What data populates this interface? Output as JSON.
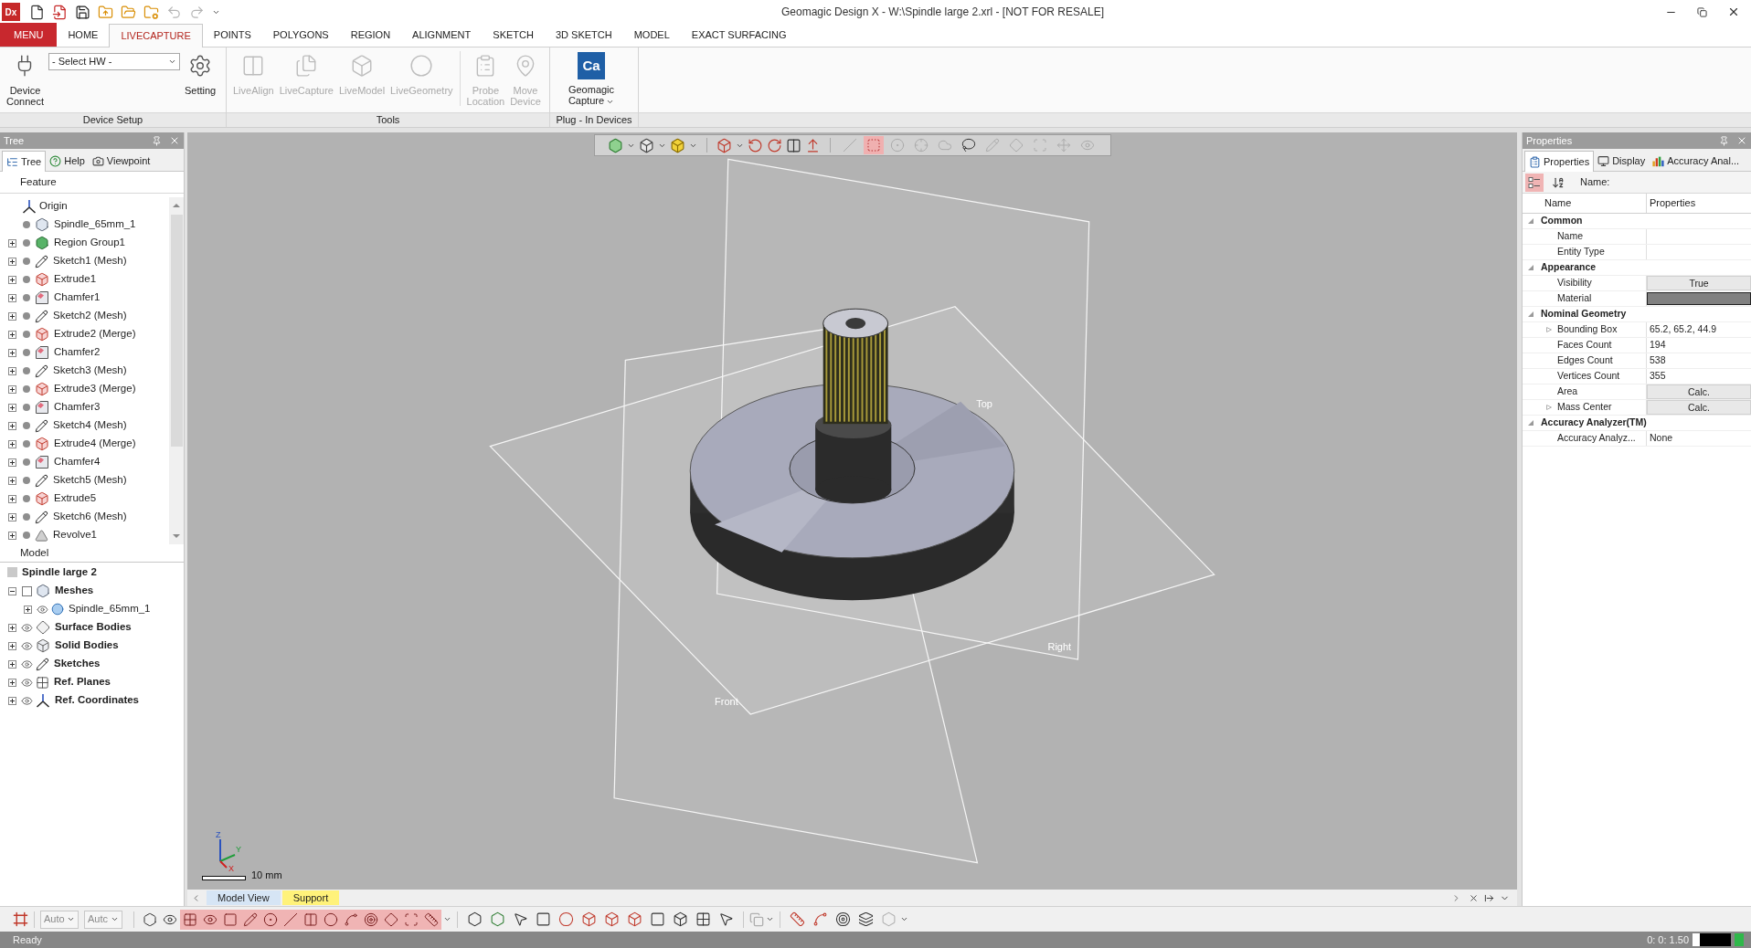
{
  "title_bar": {
    "logo": "Dx",
    "quick_access": [
      {
        "disabled": false
      },
      {
        "disabled": false
      },
      {
        "disabled": false
      },
      {
        "disabled": false
      },
      {
        "disabled": false
      },
      {
        "disabled": false
      },
      {
        "disabled": true
      },
      {
        "disabled": true
      }
    ],
    "title": "Geomagic Design X - W:\\Spindle large 2.xrl - [NOT FOR RESALE]"
  },
  "ribbon_tabs": [
    {
      "label": "MENU",
      "kind": "menu",
      "selected": false
    },
    {
      "label": "HOME",
      "kind": "tab",
      "selected": false
    },
    {
      "label": "LIVECAPTURE",
      "kind": "tab",
      "selected": true
    },
    {
      "label": "POINTS",
      "kind": "tab",
      "selected": false
    },
    {
      "label": "POLYGONS",
      "kind": "tab",
      "selected": false
    },
    {
      "label": "REGION",
      "kind": "tab",
      "selected": false
    },
    {
      "label": "ALIGNMENT",
      "kind": "tab",
      "selected": false
    },
    {
      "label": "SKETCH",
      "kind": "tab",
      "selected": false
    },
    {
      "label": "3D SKETCH",
      "kind": "tab",
      "selected": false
    },
    {
      "label": "MODEL",
      "kind": "tab",
      "selected": false
    },
    {
      "label": "EXACT SURFACING",
      "kind": "tab",
      "selected": false
    }
  ],
  "ribbon": {
    "groups": [
      {
        "label": "Device Setup",
        "sections": [
          [
            {
              "kind": "button",
              "label": "Device Connect",
              "disabled": false
            },
            {
              "kind": "dropdown",
              "value": "- Select HW -"
            },
            {
              "kind": "button",
              "label": "Setting",
              "disabled": false
            }
          ]
        ]
      },
      {
        "label": "Tools",
        "sections": [
          [
            {
              "kind": "button",
              "label": "LiveAlign",
              "disabled": true
            },
            {
              "kind": "button",
              "label": "LiveCapture",
              "disabled": true
            },
            {
              "kind": "button",
              "label": "LiveModel",
              "disabled": true
            },
            {
              "kind": "button",
              "label": "LiveGeometry",
              "disabled": true
            }
          ],
          [
            {
              "kind": "button",
              "label": "Probe Location",
              "disabled": true
            },
            {
              "kind": "button",
              "label": "Move Device",
              "disabled": true
            }
          ]
        ]
      },
      {
        "label": "Plug - In Devices",
        "sections": [
          [
            {
              "kind": "logo",
              "logo": "Ca",
              "label": "Geomagic Capture",
              "disabled": false
            }
          ]
        ]
      }
    ]
  },
  "tree_panel": {
    "title": "Tree",
    "tabs": [
      {
        "label": "Tree",
        "selected": true
      },
      {
        "label": "Help",
        "selected": false
      },
      {
        "label": "Viewpoint",
        "selected": false
      }
    ],
    "feature_header": "Feature",
    "features": [
      {
        "label": "Origin",
        "kind": "origin"
      },
      {
        "label": "Spindle_65mm_1",
        "kind": "mesh"
      },
      {
        "label": "Region Group1",
        "kind": "region",
        "expanded": false
      },
      {
        "label": "Sketch1 (Mesh)",
        "kind": "sketch",
        "expanded": false
      },
      {
        "label": "Extrude1",
        "kind": "extrude",
        "expanded": false
      },
      {
        "label": "Chamfer1",
        "kind": "chamfer",
        "expanded": false
      },
      {
        "label": "Sketch2 (Mesh)",
        "kind": "sketch",
        "expanded": false
      },
      {
        "label": "Extrude2 (Merge)",
        "kind": "extrude",
        "expanded": false
      },
      {
        "label": "Chamfer2",
        "kind": "chamfer",
        "expanded": false
      },
      {
        "label": "Sketch3 (Mesh)",
        "kind": "sketch",
        "expanded": false
      },
      {
        "label": "Extrude3 (Merge)",
        "kind": "extrude",
        "expanded": false
      },
      {
        "label": "Chamfer3",
        "kind": "chamfer",
        "expanded": false
      },
      {
        "label": "Sketch4 (Mesh)",
        "kind": "sketch",
        "expanded": false
      },
      {
        "label": "Extrude4 (Merge)",
        "kind": "extrude",
        "expanded": false
      },
      {
        "label": "Chamfer4",
        "kind": "chamfer",
        "expanded": false
      },
      {
        "label": "Sketch5 (Mesh)",
        "kind": "sketch",
        "expanded": false
      },
      {
        "label": "Extrude5",
        "kind": "extrude",
        "expanded": false
      },
      {
        "label": "Sketch6 (Mesh)",
        "kind": "sketch",
        "expanded": false
      },
      {
        "label": "Revolve1",
        "kind": "revolve",
        "expanded": false
      }
    ],
    "model_header": "Model",
    "model": {
      "label": "Spindle large 2",
      "kind": "root",
      "children": [
        {
          "label": "Meshes",
          "kind": "meshes",
          "expanded": true,
          "checked": false,
          "children": [
            {
              "label": "Spindle_65mm_1",
              "kind": "entity",
              "expanded": false
            }
          ]
        },
        {
          "label": "Surface Bodies",
          "kind": "surface",
          "expanded": false
        },
        {
          "label": "Solid Bodies",
          "kind": "solid",
          "expanded": false
        },
        {
          "label": "Sketches",
          "kind": "sketches",
          "expanded": false
        },
        {
          "label": "Ref. Planes",
          "kind": "planes",
          "expanded": false
        },
        {
          "label": "Ref. Coordinates",
          "kind": "coordinates",
          "expanded": false
        }
      ]
    }
  },
  "viewport": {
    "selection_tools": [
      {
        "on": false,
        "disabled": true
      },
      {
        "on": true,
        "disabled": false
      },
      {
        "on": false,
        "disabled": true
      },
      {
        "on": false,
        "disabled": true
      },
      {
        "on": false,
        "disabled": true
      },
      {
        "on": false,
        "disabled": false
      },
      {
        "on": false,
        "disabled": true
      },
      {
        "on": false,
        "disabled": true
      },
      {
        "on": false,
        "disabled": true
      },
      {
        "on": false,
        "disabled": true
      },
      {
        "on": false,
        "disabled": true
      }
    ],
    "plane_labels": [
      "Top",
      "Right",
      "Front"
    ],
    "axes": [
      "Z",
      "Y",
      "X"
    ],
    "scale": "10 mm",
    "tabs": [
      {
        "label": "Model View",
        "color": "#d6e5f5"
      },
      {
        "label": "Support",
        "color": "#fff27a"
      }
    ]
  },
  "properties_panel": {
    "title": "Properties",
    "tabs": [
      {
        "label": "Properties",
        "selected": true
      },
      {
        "label": "Display",
        "selected": false
      },
      {
        "label": "Accuracy Anal...",
        "selected": false
      }
    ],
    "view_buttons": [
      {
        "on": true
      },
      {
        "on": false
      }
    ],
    "name_label": "Name:",
    "columns": [
      "Name",
      "Properties"
    ],
    "groups": [
      {
        "name": "Common",
        "expanded": true,
        "rows": [
          {
            "name": "Name",
            "kind": "empty"
          },
          {
            "name": "Entity Type",
            "kind": "empty"
          }
        ]
      },
      {
        "name": "Appearance",
        "expanded": true,
        "rows": [
          {
            "name": "Visibility",
            "kind": "button",
            "value": "True"
          },
          {
            "name": "Material",
            "kind": "swatch",
            "color": "#808080"
          }
        ]
      },
      {
        "name": "Nominal Geometry",
        "expanded": true,
        "rows": [
          {
            "name": "Bounding Box",
            "kind": "text",
            "value": "65.2, 65.2, 44.9",
            "expanded": false
          },
          {
            "name": "Faces Count",
            "kind": "text",
            "value": "194"
          },
          {
            "name": "Edges Count",
            "kind": "text",
            "value": "538"
          },
          {
            "name": "Vertices Count",
            "kind": "text",
            "value": "355"
          },
          {
            "name": "Area",
            "kind": "button",
            "value": "Calc."
          },
          {
            "name": "Mass Center",
            "kind": "button",
            "value": "Calc.",
            "expanded": false
          }
        ]
      },
      {
        "name": "Accuracy Analyzer(TM)",
        "expanded": true,
        "rows": [
          {
            "name": "Accuracy Analyz...",
            "kind": "text",
            "value": "None"
          }
        ]
      }
    ]
  },
  "bottom_toolbar": {
    "dropdowns": [
      {
        "value": "Auto"
      },
      {
        "value": "Autc"
      }
    ],
    "filters": [
      {
        "on": false
      },
      {
        "on": false
      },
      {
        "on": true
      },
      {
        "on": true
      },
      {
        "on": true
      },
      {
        "on": true
      },
      {
        "on": true
      },
      {
        "on": true
      },
      {
        "on": true
      },
      {
        "on": true
      },
      {
        "on": true
      },
      {
        "on": true
      },
      {
        "on": true
      },
      {
        "on": true
      },
      {
        "on": true
      }
    ]
  },
  "status_bar": {
    "text": "Ready",
    "timer": "0: 0: 1.50"
  }
}
